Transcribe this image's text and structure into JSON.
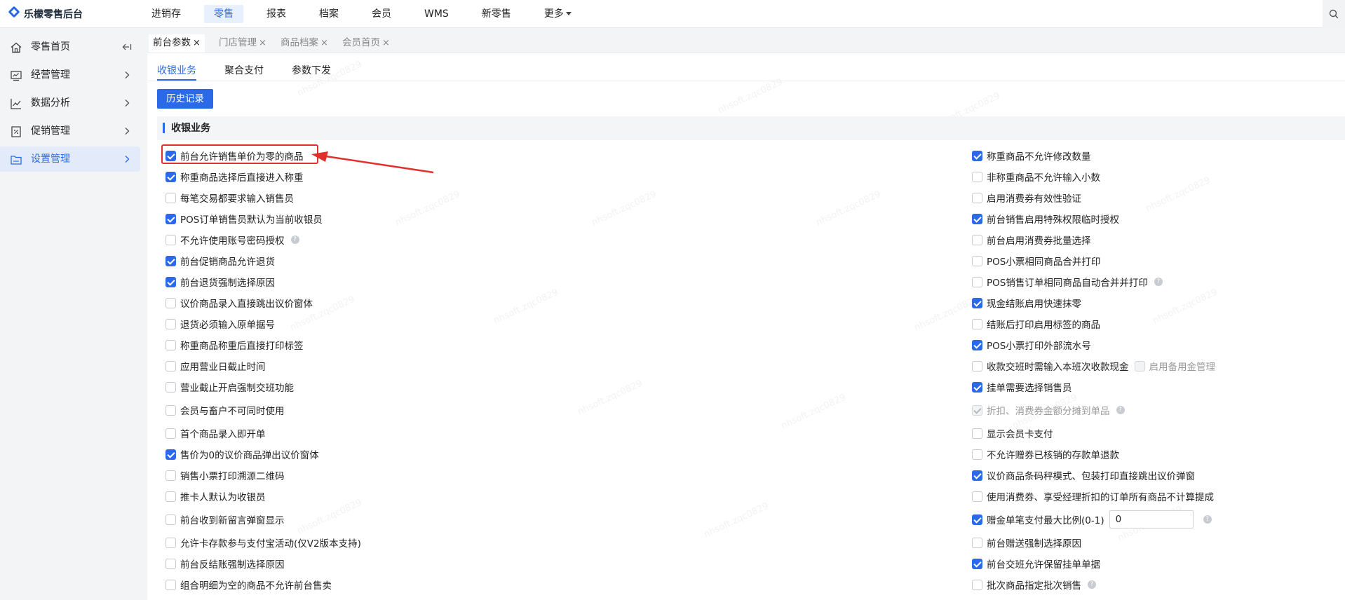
{
  "app": {
    "title": "乐檬零售后台"
  },
  "topnav": [
    "进销存",
    "零售",
    "报表",
    "档案",
    "会员",
    "WMS",
    "新零售",
    "更多"
  ],
  "sidebar": [
    "零售首页",
    "经营管理",
    "数据分析",
    "促销管理",
    "设置管理"
  ],
  "tabs": [
    "前台参数",
    "门店管理",
    "商品档案",
    "会员首页"
  ],
  "subtabs": [
    "收银业务",
    "聚合支付",
    "参数下发"
  ],
  "history_button": "历史记录",
  "section_title": "收银业务",
  "left_options": [
    {
      "label": "前台允许销售单价为零的商品",
      "checked": true
    },
    {
      "label": "称重商品选择后直接进入称重",
      "checked": true
    },
    {
      "label": "每笔交易都要求输入销售员",
      "checked": false
    },
    {
      "label": "POS订单销售员默认为当前收银员",
      "checked": true
    },
    {
      "label": "不允许使用账号密码授权",
      "checked": false
    },
    {
      "label": "前台促销商品允许退货",
      "checked": true
    },
    {
      "label": "前台退货强制选择原因",
      "checked": true
    },
    {
      "label": "议价商品录入直接跳出议价窗体",
      "checked": false
    },
    {
      "label": "退货必须输入原单据号",
      "checked": false
    },
    {
      "label": "称重商品称重后直接打印标签",
      "checked": false
    },
    {
      "label": "应用营业日截止时间",
      "checked": false
    },
    {
      "label": "营业截止开启强制交班功能",
      "checked": false
    },
    {
      "label": "会员与畜户不可同时使用",
      "checked": false
    },
    {
      "label": "首个商品录入即开单",
      "checked": false
    },
    {
      "label": "售价为0的议价商品弹出议价窗体",
      "checked": true
    },
    {
      "label": "销售小票打印溯源二维码",
      "checked": false
    },
    {
      "label": "推卡人默认为收银员",
      "checked": false
    },
    {
      "label": "前台收到新留言弹窗显示",
      "checked": false
    },
    {
      "label": "允许卡存款参与支付宝活动(仅V2版本支持)",
      "checked": false
    },
    {
      "label": "前台反结账强制选择原因",
      "checked": false
    },
    {
      "label": "组合明细为空的商品不允许前台售卖",
      "checked": false
    }
  ],
  "right_options": [
    {
      "label": "称重商品不允许修改数量",
      "checked": true
    },
    {
      "label": "非称重商品不允许输入小数",
      "checked": false
    },
    {
      "label": "启用消费券有效性验证",
      "checked": false
    },
    {
      "label": "前台销售启用特殊权限临时授权",
      "checked": true
    },
    {
      "label": "前台启用消费券批量选择",
      "checked": false
    },
    {
      "label": "POS小票相同商品合并打印",
      "checked": false
    },
    {
      "label": "POS销售订单相同商品自动合并并打印",
      "checked": false
    },
    {
      "label": "现金结账启用快速抹零",
      "checked": true
    },
    {
      "label": "结账后打印启用标签的商品",
      "checked": false
    },
    {
      "label": "POS小票打印外部流水号",
      "checked": true
    },
    {
      "label": "收款交班时需输入本班次收款现金",
      "checked": false
    },
    {
      "label": "挂单需要选择销售员",
      "checked": true
    },
    {
      "label": "折扣、消费券金额分摊到单品",
      "checked": true
    },
    {
      "label": "显示会员卡支付",
      "checked": false
    },
    {
      "label": "不允许赠券已核销的存款单退款",
      "checked": false
    },
    {
      "label": "议价商品条码秤模式、包装打印直接跳出议价弹窗",
      "checked": true
    },
    {
      "label": "使用消费券、享受经理折扣的订单所有商品不计算提成",
      "checked": false
    },
    {
      "label": "赠金单笔支付最大比例(0-1)",
      "checked": true
    },
    {
      "label": "前台赠送强制选择原因",
      "checked": false
    },
    {
      "label": "前台交班允许保留挂单单据",
      "checked": true
    },
    {
      "label": "批次商品指定批次销售",
      "checked": false
    }
  ],
  "extra": {
    "backup_cash_label": "启用备用金管理",
    "ratio_value": "0"
  },
  "help_glyph": "?",
  "close_glyph": "×",
  "watermark": "nhsoft.zqc0829"
}
